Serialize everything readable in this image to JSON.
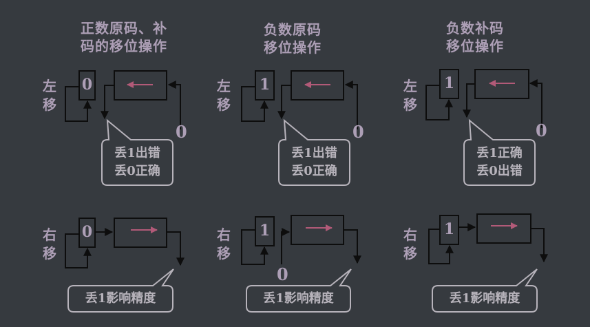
{
  "panels": [
    {
      "title": [
        "正数原码、补",
        "码的移位操作"
      ],
      "left": {
        "side": [
          "左",
          "移"
        ],
        "bit": "0",
        "zero": "0",
        "callout": [
          "丢1出错",
          "丢0正确"
        ]
      },
      "right": {
        "side": [
          "右",
          "移"
        ],
        "bit": "0",
        "callout": [
          "丢1影响精度"
        ]
      }
    },
    {
      "title": [
        "负数原码",
        "移位操作"
      ],
      "left": {
        "side": [
          "左",
          "移"
        ],
        "bit": "1",
        "zero": "0",
        "callout": [
          "丢1出错",
          "丢0正确"
        ]
      },
      "right": {
        "side": [
          "右",
          "移"
        ],
        "bit": "1",
        "zero": "0",
        "callout": [
          "丢1影响精度"
        ]
      }
    },
    {
      "title": [
        "负数补码",
        "移位操作"
      ],
      "left": {
        "side": [
          "左",
          "移"
        ],
        "bit": "1",
        "zero": "0",
        "callout": [
          "丢1正确",
          "丢0出错"
        ]
      },
      "right": {
        "side": [
          "右",
          "移"
        ],
        "bit": "1",
        "callout": [
          "丢1影响精度"
        ]
      }
    }
  ],
  "colors": {
    "background": "#363a3f",
    "text": "#ad9fb6",
    "arrow_in_box": "#b25a78",
    "lines": "#0d0d0d",
    "callout_border": "#b7b3bb"
  }
}
